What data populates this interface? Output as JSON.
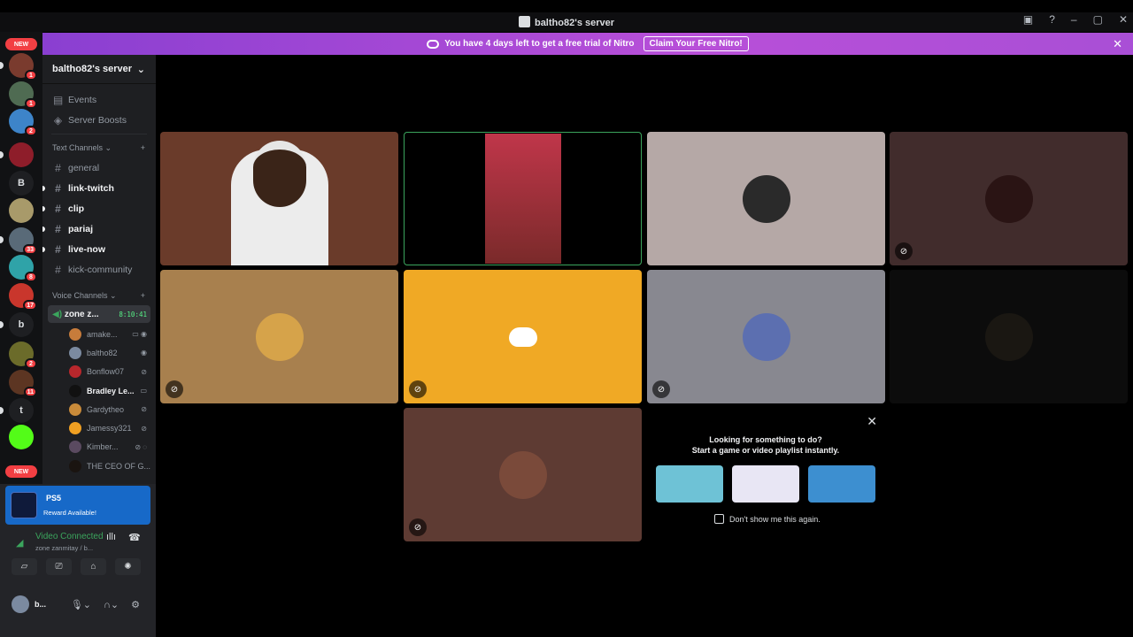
{
  "titlebar": {
    "title": "baltho82's server"
  },
  "banner": {
    "text": "You have 4 days left to get a free trial of Nitro",
    "claim_label": "Claim Your Free Nitro!"
  },
  "guilds": {
    "new_label": "NEW",
    "items": [
      {
        "letter": "",
        "color": "#7a3b2e",
        "badge": "1"
      },
      {
        "letter": "",
        "color": "#4f6b52",
        "badge": "1"
      },
      {
        "letter": "",
        "color": "#3d84c9",
        "badge": "2"
      },
      {
        "letter": "",
        "color": "#8e1d2a",
        "badge": ""
      },
      {
        "letter": "B",
        "color": "#1e1f22",
        "badge": ""
      },
      {
        "letter": "",
        "color": "#a89a6a",
        "badge": ""
      },
      {
        "letter": "",
        "color": "#596a78",
        "badge": "33"
      },
      {
        "letter": "",
        "color": "#2fa3a8",
        "badge": "8"
      },
      {
        "letter": "",
        "color": "#c9362c",
        "badge": "17"
      },
      {
        "letter": "b",
        "color": "#1e1f22",
        "badge": ""
      },
      {
        "letter": "",
        "color": "#6b6b2a",
        "badge": "2"
      },
      {
        "letter": "",
        "color": "#5c3522",
        "badge": "11"
      },
      {
        "letter": "t",
        "color": "#1e1f22",
        "badge": ""
      },
      {
        "letter": "",
        "color": "#53fc18",
        "badge": ""
      }
    ]
  },
  "server": {
    "name": "baltho82's server"
  },
  "menu": {
    "events": "Events",
    "boosts": "Server Boosts"
  },
  "text_channels": {
    "label": "Text Channels",
    "items": [
      {
        "name": "general",
        "unread": false
      },
      {
        "name": "link-twitch",
        "unread": true
      },
      {
        "name": "clip",
        "unread": true
      },
      {
        "name": "pariaj",
        "unread": true
      },
      {
        "name": "live-now",
        "unread": true
      },
      {
        "name": "kick-community",
        "unread": false
      }
    ]
  },
  "voice_channels": {
    "label": "Voice Channels",
    "active": {
      "name": "zone z...",
      "timer": "8:10:41"
    },
    "users": [
      {
        "name": "amake...",
        "color": "#c77c3b",
        "bold": false,
        "status": "▭ ◉"
      },
      {
        "name": "baltho82",
        "color": "#7b8aa0",
        "bold": false,
        "status": "◉"
      },
      {
        "name": "Bonflow07",
        "color": "#b8272c",
        "bold": false,
        "status": "⊘"
      },
      {
        "name": "Bradley Le...",
        "color": "#111111",
        "bold": true,
        "status": "▭"
      },
      {
        "name": "Gardytheo",
        "color": "#c98b3a",
        "bold": false,
        "status": "⊘"
      },
      {
        "name": "Jamessy321",
        "color": "#f0a022",
        "bold": false,
        "status": "⊘"
      },
      {
        "name": "Kimber...",
        "color": "#5a4a60",
        "bold": false,
        "status": "⊘ ◌"
      },
      {
        "name": "THE CEO OF G...",
        "color": "#1a1410",
        "bold": false,
        "status": ""
      }
    ]
  },
  "ps5": {
    "title": "PS5",
    "subtitle": "Reward Available!"
  },
  "connection": {
    "status": "Video Connected",
    "channel": "zone zanmitay / b..."
  },
  "user": {
    "name": "b..."
  },
  "tiles": [
    {
      "kind": "video",
      "bg": "#6a3b2a",
      "muted": false
    },
    {
      "kind": "video",
      "bg": "#000000",
      "muted": false
    },
    {
      "kind": "avatar",
      "bg": "#b5a8a6",
      "avatar": "#2a2a2a",
      "muted": false
    },
    {
      "kind": "avatar",
      "bg": "#412c2c",
      "avatar": "#2a1414",
      "muted": true
    },
    {
      "kind": "avatar",
      "bg": "#a8804e",
      "avatar": "#d6a34a",
      "muted": true
    },
    {
      "kind": "discord",
      "bg": "#f0a925",
      "muted": true
    },
    {
      "kind": "avatar",
      "bg": "#888890",
      "avatar": "#5c6fb0",
      "muted": true
    },
    {
      "kind": "avatar",
      "bg": "#0c0c0c",
      "avatar": "#1a1712",
      "muted": false
    },
    {
      "kind": "avatar",
      "bg": "#5e3b33",
      "avatar": "#7a4a3a",
      "muted": true
    }
  ],
  "activity": {
    "line1": "Looking for something to do?",
    "line2": "Start a game or video playlist instantly.",
    "checkbox_label": "Don't show me this again.",
    "cards": [
      {
        "color": "#6ec2d6"
      },
      {
        "color": "#e8e6f4"
      },
      {
        "color": "#3d8fd0"
      }
    ]
  }
}
